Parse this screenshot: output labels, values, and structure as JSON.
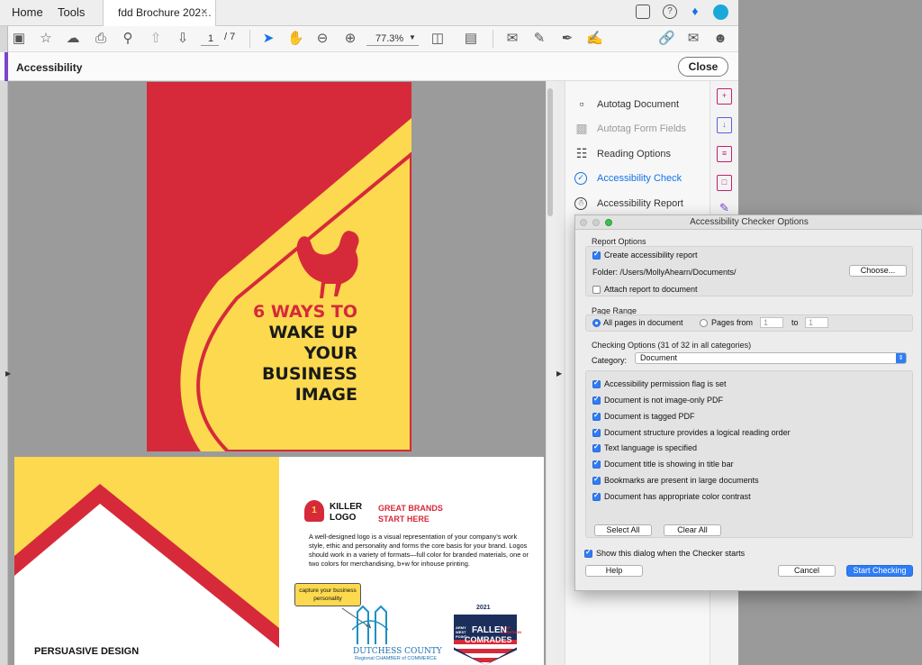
{
  "tabs": {
    "home": "Home",
    "tools": "Tools",
    "document": "fdd Brochure 202…",
    "close_glyph": "×"
  },
  "toolbar": {
    "page_current": "1",
    "page_total": "/ 7",
    "zoom": "77.3%"
  },
  "accessibility": {
    "title": "Accessibility",
    "close_label": "Close"
  },
  "tools_panel": {
    "items": [
      {
        "label": "Autotag Document",
        "icon": "autotag-icon",
        "state": "normal"
      },
      {
        "label": "Autotag Form Fields",
        "icon": "form-fields-icon",
        "state": "disabled"
      },
      {
        "label": "Reading Options",
        "icon": "reading-options-icon",
        "state": "normal"
      },
      {
        "label": "Accessibility Check",
        "icon": "check-circle-icon",
        "state": "active"
      },
      {
        "label": "Accessibility Report",
        "icon": "accessibility-person-icon",
        "state": "normal"
      }
    ]
  },
  "page1": {
    "line1": "6 WAYS TO",
    "line2": "WAKE UP",
    "line3": "YOUR",
    "line4": "BUSINESS",
    "line5": "IMAGE"
  },
  "page2": {
    "killer": "KILLER",
    "logo_word": "LOGO",
    "badge_num": "1",
    "great": "GREAT BRANDS",
    "start": "START HERE",
    "body": "A well-designed logo is a visual representation of your company’s work style, ethic and personality and forms the core basis for your brand. Logos should work in a variety of formats—full color for branded materials, one or two colors for merchandising, b+w for inhouse printing.",
    "callout": "capture your business personality",
    "dutchess1": "DUTCHESS COUNTY",
    "dutchess2": "Regional CHAMBER of COMMERCE",
    "fc_year": "2021",
    "fc_army": "ARMY WEST POINT",
    "fc_half": "HALF MARATHON",
    "fc_fallen": "FALLEN",
    "fc_comrades": "COMRADES",
    "persuasive": "PERSUASIVE DESIGN"
  },
  "dialog": {
    "title": "Accessibility Checker Options",
    "report_options": "Report Options",
    "create_report": "Create accessibility report",
    "folder": "Folder: /Users/MollyAhearn/Documents/",
    "choose": "Choose...",
    "attach": "Attach report to document",
    "page_range": "Page Range",
    "all_pages": "All pages in document",
    "pages_from": "Pages from",
    "from_val": "1",
    "to": "to",
    "to_val": "1",
    "checking_options": "Checking Options (31 of 32 in all categories)",
    "category_label": "Category:",
    "category_value": "Document",
    "checks": [
      "Accessibility permission flag is set",
      "Document is not image-only PDF",
      "Document is tagged PDF",
      "Document structure provides a logical reading order",
      "Text language is specified",
      "Document title is showing in title bar",
      "Bookmarks are present in large documents",
      "Document has appropriate color contrast"
    ],
    "select_all": "Select All",
    "clear_all": "Clear All",
    "show_dialog": "Show this dialog when the Checker starts",
    "help": "Help",
    "cancel": "Cancel",
    "start": "Start Checking"
  },
  "colors": {
    "accent": "#1473e6",
    "brand_red": "#d62a3a",
    "brand_yellow": "#fcd94f",
    "purple": "#7b45c9"
  }
}
